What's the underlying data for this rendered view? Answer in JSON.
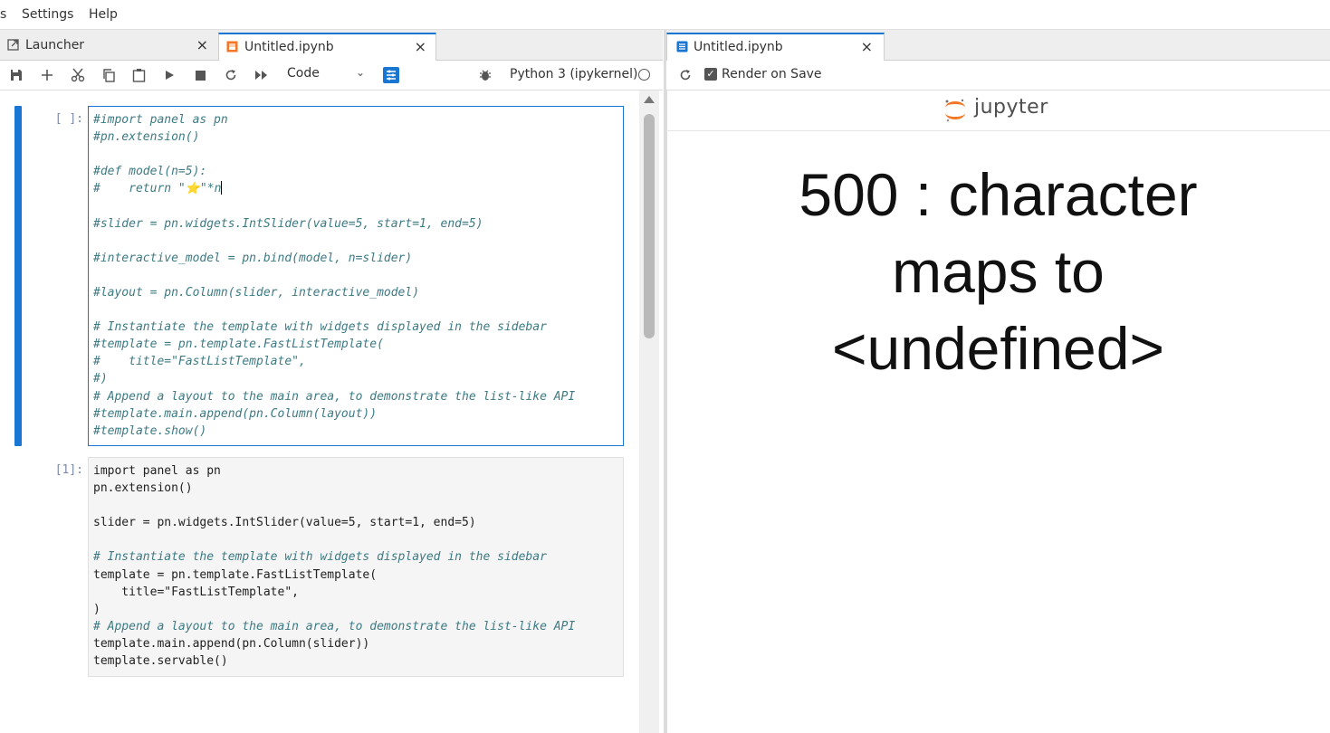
{
  "menu": {
    "items": [
      "s",
      "Settings",
      "Help"
    ]
  },
  "left_tabs": [
    {
      "label": "Launcher",
      "close": "×",
      "active": false
    },
    {
      "label": "Untitled.ipynb",
      "close": "×",
      "active": true
    }
  ],
  "toolbar": {
    "cell_type": "Code",
    "kernel_name": "Python 3 (ipykernel)"
  },
  "cells": [
    {
      "prompt": "[ ]:",
      "lines": [
        "#import panel as pn",
        "#pn.extension()",
        "",
        "#def model(n=5):",
        "#    return \"⭐\"*n",
        "",
        "#slider = pn.widgets.IntSlider(value=5, start=1, end=5)",
        "",
        "#interactive_model = pn.bind(model, n=slider)",
        "",
        "#layout = pn.Column(slider, interactive_model)",
        "",
        "# Instantiate the template with widgets displayed in the sidebar",
        "#template = pn.template.FastListTemplate(",
        "#    title=\"FastListTemplate\",",
        "#)",
        "# Append a layout to the main area, to demonstrate the list-like API",
        "#template.main.append(pn.Column(layout))",
        "#template.show()"
      ]
    },
    {
      "prompt": "[1]:",
      "lines": [
        "import panel as pn",
        "pn.extension()",
        "",
        "slider = pn.widgets.IntSlider(value=5, start=1, end=5)",
        "",
        "# Instantiate the template with widgets displayed in the sidebar",
        "template = pn.template.FastListTemplate(",
        "    title=\"FastListTemplate\",",
        ")",
        "# Append a layout to the main area, to demonstrate the list-like API",
        "template.main.append(pn.Column(slider))",
        "template.servable()"
      ]
    }
  ],
  "right_tab": {
    "label": "Untitled.ipynb",
    "close": "×"
  },
  "preview": {
    "render_on_save_label": "Render on Save",
    "render_on_save_checked": true,
    "logo_text": "jupyter",
    "error_lines": [
      "500 : character",
      "maps to",
      "<undefined>"
    ]
  },
  "colors": {
    "accent": "#1976d2",
    "jupyter_orange": "#f37726",
    "comment": "#3d7a83",
    "keyword": "#008000",
    "string": "#ba2121"
  }
}
